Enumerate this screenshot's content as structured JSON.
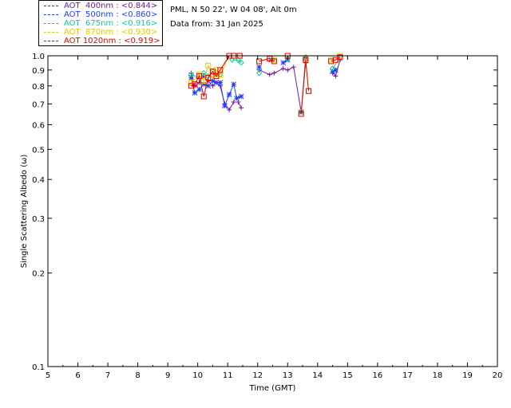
{
  "legend": [
    {
      "label": "AOT  400nm : <0.844>",
      "color": "#7a14a8"
    },
    {
      "label": "AOT  500nm : <0.860>",
      "color": "#1e3cff"
    },
    {
      "label": "AOT  675nm : <0.916>",
      "color": "#00d2a0"
    },
    {
      "label": "AOT  870nm : <0.930>",
      "color": "#e6c800"
    },
    {
      "label": "AOT 1020nm : <0.919>",
      "color": "#e60000"
    }
  ],
  "info": {
    "site": "PML, N 50 22', W 04 08', Alt 0m",
    "date": "Data from: 31 Jan 2025"
  },
  "chart_data": {
    "type": "scatter",
    "xlabel": "Time (GMT)",
    "ylabel": "Single Scattering Albedo (ω)",
    "xlim": [
      5,
      20
    ],
    "ylim": [
      0.1,
      1.0
    ],
    "yscale": "log",
    "xticks": [
      "5",
      "6",
      "7",
      "8",
      "9",
      "10",
      "11",
      "12",
      "13",
      "14",
      "15",
      "16",
      "17",
      "18",
      "19",
      "20"
    ],
    "yticks": [
      {
        "v": 1.0,
        "label": "1.0"
      },
      {
        "v": 0.9,
        "label": "0.9"
      },
      {
        "v": 0.8,
        "label": "0.8"
      },
      {
        "v": 0.7,
        "label": "0.7"
      },
      {
        "v": 0.6,
        "label": "0.6"
      },
      {
        "v": 0.5,
        "label": "0.5"
      },
      {
        "v": 0.4,
        "label": "0.4"
      },
      {
        "v": 0.3,
        "label": "0.3"
      },
      {
        "v": 0.2,
        "label": "0.2"
      },
      {
        "v": 0.1,
        "label": "0.1"
      }
    ],
    "series": [
      {
        "name": "AOT  400nm : <0.844>",
        "color": "#7a14a8",
        "marker": "plus",
        "x": [
          9.78,
          9.9,
          10.05,
          10.2,
          10.35,
          10.5,
          10.62,
          10.75,
          10.9,
          11.05,
          11.2,
          11.35,
          11.45,
          12.05,
          12.4,
          12.55,
          12.85,
          13.0,
          13.2,
          13.45,
          13.6,
          14.5,
          14.6,
          14.75
        ],
        "y": [
          0.88,
          0.8,
          0.82,
          0.86,
          0.83,
          0.8,
          0.82,
          0.8,
          0.7,
          0.67,
          0.71,
          0.71,
          0.68,
          0.9,
          0.87,
          0.88,
          0.91,
          0.9,
          0.92,
          0.66,
          0.95,
          0.88,
          0.86,
          0.97
        ]
      },
      {
        "name": "AOT  500nm : <0.860>",
        "color": "#1e3cff",
        "marker": "asterisk",
        "x": [
          9.78,
          9.9,
          10.05,
          10.2,
          10.35,
          10.5,
          10.62,
          10.75,
          10.9,
          11.05,
          11.2,
          11.3,
          11.45,
          12.05,
          12.45,
          12.85,
          13.0,
          13.45,
          13.6,
          14.5,
          14.6
        ],
        "y": [
          0.85,
          0.76,
          0.78,
          0.81,
          0.8,
          0.83,
          0.82,
          0.82,
          0.69,
          0.75,
          0.81,
          0.73,
          0.74,
          0.92,
          0.97,
          0.95,
          0.97,
          0.66,
          0.98,
          0.89,
          0.9
        ]
      },
      {
        "name": "AOT  675nm : <0.916>",
        "color": "#00d2a0",
        "marker": "diamond",
        "x": [
          9.78,
          10.05,
          10.2,
          10.35,
          10.5,
          10.62,
          10.75,
          11.15,
          11.35,
          11.45,
          12.05,
          12.5,
          13.0,
          13.45,
          13.6,
          14.5,
          14.75
        ],
        "y": [
          0.87,
          0.85,
          0.88,
          0.86,
          0.89,
          0.87,
          0.87,
          0.97,
          0.97,
          0.95,
          0.88,
          0.97,
          0.98,
          0.66,
          0.99,
          0.91,
          0.99
        ]
      },
      {
        "name": "AOT  870nm : <0.930>",
        "color": "#e6c800",
        "marker": "square",
        "x": [
          9.78,
          10.05,
          10.2,
          10.35,
          10.5,
          10.62,
          10.75,
          11.05,
          11.2,
          11.4,
          12.05,
          12.4,
          12.55,
          13.0,
          13.45,
          13.6,
          13.7,
          14.45,
          14.6,
          14.75
        ],
        "y": [
          0.82,
          0.87,
          0.83,
          0.93,
          0.87,
          0.9,
          0.87,
          1.0,
          1.0,
          1.0,
          0.96,
          0.98,
          0.97,
          1.0,
          0.66,
          0.98,
          0.77,
          0.97,
          0.97,
          1.0
        ]
      },
      {
        "name": "AOT 1020nm : <0.919>",
        "color": "#e60000",
        "marker": "square",
        "x": [
          9.78,
          9.9,
          10.05,
          10.2,
          10.35,
          10.5,
          10.62,
          10.75,
          11.05,
          11.2,
          11.4,
          12.05,
          12.4,
          12.55,
          13.0,
          13.45,
          13.6,
          13.7,
          14.45,
          14.6,
          14.75
        ],
        "y": [
          0.8,
          0.81,
          0.86,
          0.74,
          0.85,
          0.89,
          0.86,
          0.9,
          1.0,
          1.0,
          1.0,
          0.96,
          0.98,
          0.96,
          1.0,
          0.65,
          0.97,
          0.77,
          0.96,
          0.97,
          0.99
        ]
      }
    ]
  }
}
